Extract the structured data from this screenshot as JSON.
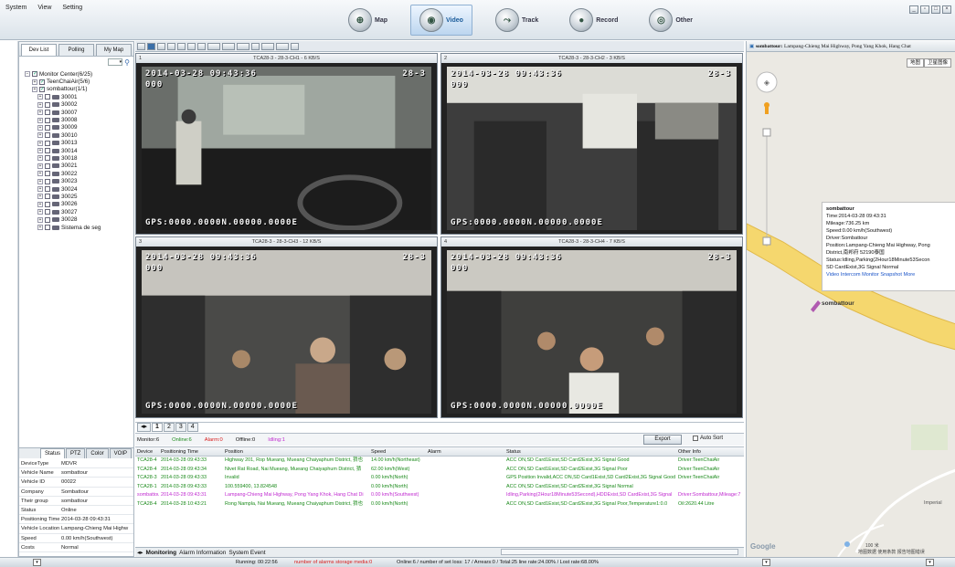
{
  "menu": [
    "System",
    "View",
    "Setting"
  ],
  "modes": [
    {
      "label": "Map",
      "icon": "map-icon",
      "active": false
    },
    {
      "label": "Video",
      "icon": "video-icon",
      "active": true
    },
    {
      "label": "Track",
      "icon": "track-icon",
      "active": false
    },
    {
      "label": "Record",
      "icon": "record-icon",
      "active": false
    },
    {
      "label": "Other",
      "icon": "other-icon",
      "active": false
    }
  ],
  "left": {
    "tabs": [
      "Dev List",
      "Polling",
      "My Map"
    ],
    "tree": {
      "root": "Monitor Center(6/25)",
      "groups": [
        "TeenChaiAir(5/6)",
        "sombattour(1/1)"
      ],
      "vehicles": [
        "30001",
        "30002",
        "30007",
        "30008",
        "30009",
        "30010",
        "30013",
        "30014",
        "30018",
        "30021",
        "30022",
        "30023",
        "30024",
        "30025",
        "30026",
        "30027",
        "30028",
        "Sistema de seg"
      ]
    },
    "status_tabs": [
      "Status",
      "PTZ",
      "Color",
      "VOIP"
    ],
    "status": [
      [
        "DeviceType",
        "MDVR"
      ],
      [
        "Vehicle Name",
        "sombattour"
      ],
      [
        "Vehicle ID",
        "00022"
      ],
      [
        "Company",
        "Sombattour"
      ],
      [
        "Their group",
        "sombattour"
      ],
      [
        "Status",
        "Online"
      ],
      [
        "Positioning Time",
        "2014-03-28 09:43:31"
      ],
      [
        "Vehicle Location",
        "Lampang-Chieng Mai Highw"
      ],
      [
        "Speed",
        "0.00 km/h(Southwest)"
      ],
      [
        "Costs",
        "Normal"
      ]
    ]
  },
  "video": {
    "cells": [
      {
        "n": "1",
        "title": "TCA28-3 - 28-3-CH1 - 6 KB/S",
        "datetime": "2014-03-28  09:43:36",
        "tag": "28-3",
        "sub": "000",
        "gps": "GPS:0000.0000N.00000.0000E"
      },
      {
        "n": "2",
        "title": "TCA28-3 - 28-3-CH2 - 3 KB/S",
        "datetime": "2014-03-28  09:43:36",
        "tag": "28-3",
        "sub": "000",
        "gps": "GPS:0000.0000N.00000.0000E"
      },
      {
        "n": "3",
        "title": "TCA28-3 - 28-3-CH3 - 12 KB/S",
        "datetime": "2014-03-28  09:43:36",
        "tag": "28-3",
        "sub": "000",
        "gps": "GPS:0000.0000N.00000.0000E"
      },
      {
        "n": "4",
        "title": "TCA28-3 - 28-3-CH4 - 7 KB/S",
        "datetime": "2014-03-28  09:43:36",
        "tag": "28-3",
        "sub": "000",
        "gps": "GPS:0000.0000N.00000.0000E"
      }
    ],
    "pages": [
      "1",
      "2",
      "3",
      "4"
    ]
  },
  "summary": {
    "monitor": "Monitor:6",
    "online": "Online:6",
    "alarm": "Alarm:0",
    "offline": "Offline:0",
    "idling": "Idling:1",
    "export": "Export",
    "autosort": "Auto Sort"
  },
  "grid": {
    "headers": [
      "Device",
      "Positioning Time",
      "Position",
      "Speed",
      "Alarm",
      "Status",
      "Other Info"
    ],
    "rows": [
      [
        "TCA28-4",
        "2014-03-28 09:43:33",
        "Highway 201, Rop Mueang, Mueang Chaiyaphum District, 猜也",
        "14.00 km/h(Northeast)",
        "",
        "ACC ON,SD Card1Exist,SD Card2Exist,3G Signal Good",
        "Driver:TeenChaiAir"
      ],
      [
        "TCA28-4",
        "2014-03-28 09:43:34",
        "Nivet Rat Road, Nai Mueang, Mueang Chaiyaphum District, 猜",
        "62.00 km/h(West)",
        "",
        "ACC ON,SD Card1Exist,SD Card2Exist,3G Signal Poor",
        "Driver:TeenChaiAir"
      ],
      [
        "TCA28-3",
        "2014-03-28 09:43:33",
        "Invalid",
        "0.00 km/h(North)",
        "",
        "GPS Position Invalid,ACC ON,SD Card1Exist,SD Card2Exist,3G Signal Good",
        "Driver:TeenChaiAir"
      ],
      [
        "TCA28-1",
        "2014-03-28 09:43:33",
        "100.559400, 13.824548",
        "0.00 km/h(North)",
        "",
        "ACC ON,SD Card1Exist,SD Card2Exist,3G Signal Normal",
        ""
      ],
      [
        "sombattour",
        "2014-03-28 09:43:31",
        "Lampang-Chieng Mai Highway, Pong Yang Khok, Hang Chat Di",
        "0.00 km/h(Southwest)",
        "",
        "Idling,Parking(2Hour18Minute53Second),HDDExist,SD CardExist,3G Signal",
        "Driver:Sombattour,Mileage:7"
      ],
      [
        "TCA28-4",
        "2014-03-28 10:43:21",
        "Rong Nampla, Nai Mueang, Mueang Chaiyaphum District, 猜也",
        "0.00 km/h(North)",
        "",
        "ACC ON,SD Card1Exist,SD Card2Exist,3G Signal Poor,Temperature1:0.0",
        "Oil:2620.44 Litre"
      ]
    ]
  },
  "bottom_tabs": [
    "Monitoring",
    "Alarm Information",
    "System Event"
  ],
  "map": {
    "header_label": "sombattour:",
    "header_text": "Lampang-Chieng Mai Highway, Pong Yang Khok, Hang Chat",
    "map_buttons": [
      "地图",
      "卫星图像"
    ],
    "popup": {
      "name": "sombattour",
      "time": "Time:2014-03-28 09:43:31",
      "mileage": "Mileage:736.25 km",
      "speed": "Speed:0.00 km/h(Southwest)",
      "driver": "Driver:Sombattour",
      "position": "Position:Lampang-Chieng Mai Highway, Pong",
      "position2": "District,南邦府 52190泰国",
      "status": "Status:Idling,Parking(2Hour18Minute53Secon",
      "status2": "SD CardExist,3G Signal Normal",
      "links": [
        "Video",
        "Intercom",
        "Monitor",
        "Snapshot",
        "More"
      ]
    },
    "marker_label": "sombattour",
    "place": "Imperial",
    "scale": "100 米",
    "copyright": "地图数据  使用条款  报告地图错误",
    "google": "Google"
  },
  "footer": {
    "running": "Running: 00:22:56",
    "alarm": "number of alarms storage media:0",
    "online": "Online:6 / number of set loss: 17 / Arrears:0 / Total:25   line rate:24.00% / Lost rate:68.00%"
  },
  "colors": {
    "online": "#1a8a1a",
    "alarm": "#d81b1b",
    "idling": "#c02ad0",
    "link": "#1a54c8"
  }
}
